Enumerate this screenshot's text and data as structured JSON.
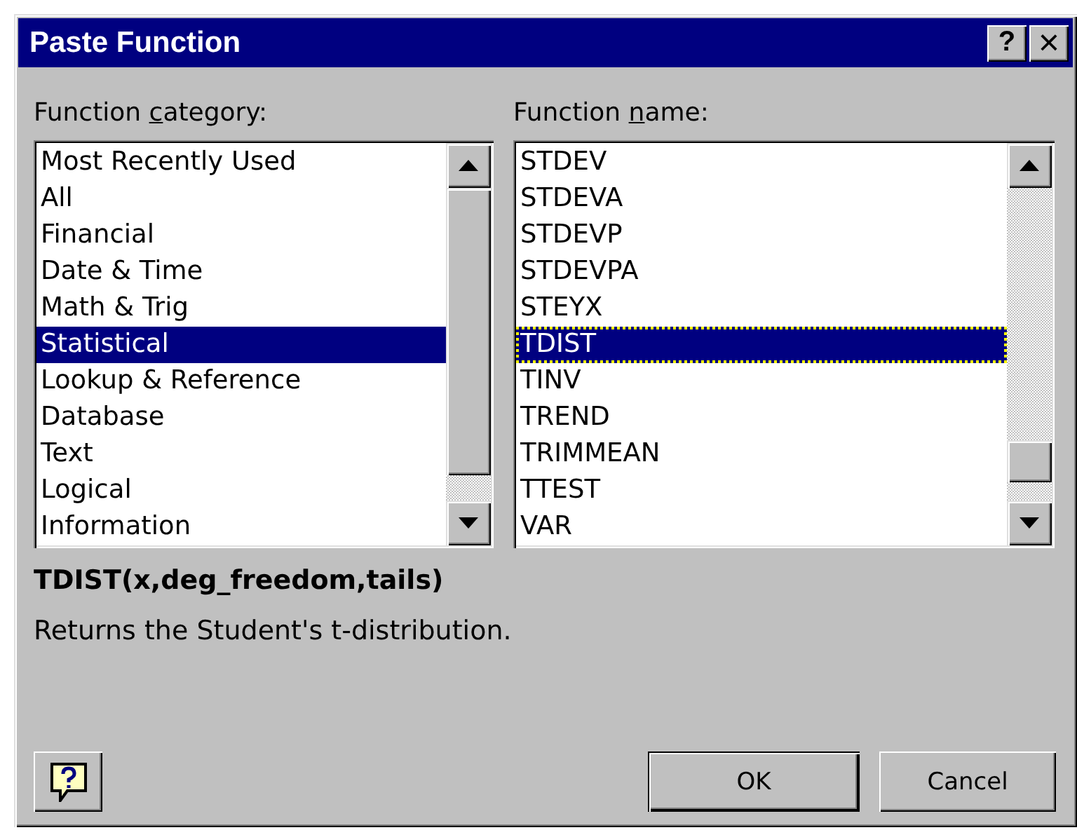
{
  "window": {
    "title": "Paste Function",
    "title_buttons": [
      {
        "kind": "help",
        "label": "?"
      },
      {
        "kind": "close",
        "label": "×"
      }
    ]
  },
  "lists": [
    {
      "label_before": "Function ",
      "access_key": "c",
      "label_after": "ategory:",
      "focused": false,
      "items": [
        {
          "label": "Most Recently Used",
          "selected": false
        },
        {
          "label": "All",
          "selected": false
        },
        {
          "label": "Financial",
          "selected": false
        },
        {
          "label": "Date & Time",
          "selected": false
        },
        {
          "label": "Math & Trig",
          "selected": false
        },
        {
          "label": "Statistical",
          "selected": true
        },
        {
          "label": "Lookup & Reference",
          "selected": false
        },
        {
          "label": "Database",
          "selected": false
        },
        {
          "label": "Text",
          "selected": false
        },
        {
          "label": "Logical",
          "selected": false
        },
        {
          "label": "Information",
          "selected": false
        }
      ]
    },
    {
      "label_before": "Function ",
      "access_key": "n",
      "label_after": "ame:",
      "focused": true,
      "items": [
        {
          "label": "STDEV",
          "selected": false
        },
        {
          "label": "STDEVA",
          "selected": false
        },
        {
          "label": "STDEVP",
          "selected": false
        },
        {
          "label": "STDEVPA",
          "selected": false
        },
        {
          "label": "STEYX",
          "selected": false
        },
        {
          "label": "TDIST",
          "selected": true
        },
        {
          "label": "TINV",
          "selected": false
        },
        {
          "label": "TREND",
          "selected": false
        },
        {
          "label": "TRIMMEAN",
          "selected": false
        },
        {
          "label": "TTEST",
          "selected": false
        },
        {
          "label": "VAR",
          "selected": false
        }
      ]
    }
  ],
  "syntax": "TDIST(x,deg_freedom,tails)",
  "description": "Returns the Student's t-distribution.",
  "buttons": [
    {
      "label": "OK"
    },
    {
      "label": "Cancel"
    }
  ]
}
